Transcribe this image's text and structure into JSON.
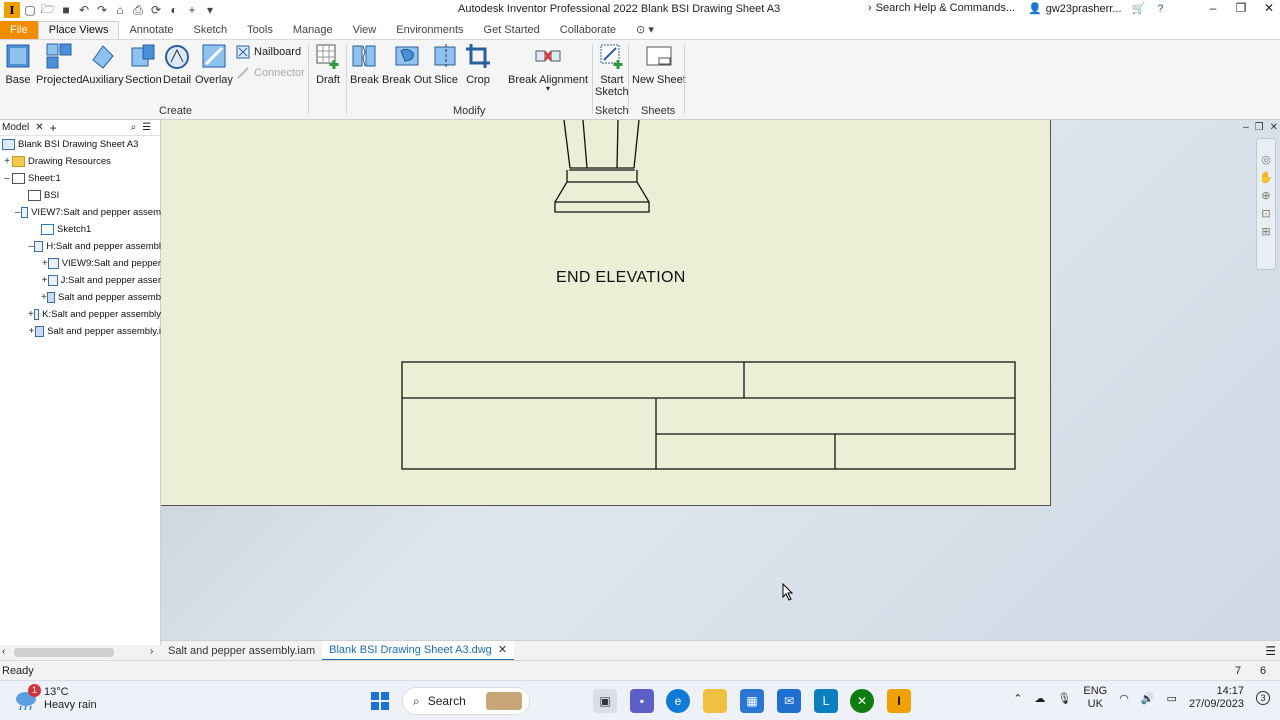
{
  "window": {
    "title": "Autodesk Inventor Professional 2022   Blank BSI Drawing Sheet A3",
    "search_placeholder": "Search Help & Commands...",
    "user": "gw23prasherr..."
  },
  "ribbon_tabs": [
    {
      "label": "File"
    },
    {
      "label": "Place Views"
    },
    {
      "label": "Annotate"
    },
    {
      "label": "Sketch"
    },
    {
      "label": "Tools"
    },
    {
      "label": "Manage"
    },
    {
      "label": "View"
    },
    {
      "label": "Environments"
    },
    {
      "label": "Get Started"
    },
    {
      "label": "Collaborate"
    }
  ],
  "ribbon": {
    "create": {
      "label": "Create",
      "base": "Base",
      "projected": "Projected",
      "auxiliary": "Auxiliary",
      "section": "Section",
      "detail": "Detail",
      "overlay": "Overlay",
      "nailboard": "Nailboard",
      "connector": "Connector",
      "draft": "Draft"
    },
    "modify": {
      "label": "Modify",
      "break": "Break",
      "break_out": "Break Out",
      "slice": "Slice",
      "crop": "Crop",
      "break_alignment": "Break Alignment"
    },
    "sketch": {
      "label": "Sketch",
      "start_sketch_1": "Start",
      "start_sketch_2": "Sketch"
    },
    "sheets": {
      "label": "Sheets",
      "new_sheet": "New Sheet"
    }
  },
  "browser": {
    "title": "Model",
    "items": [
      {
        "label": "Blank BSI Drawing Sheet A3"
      },
      {
        "label": "Drawing Resources"
      },
      {
        "label": "Sheet:1"
      },
      {
        "label": "BSI"
      },
      {
        "label": "VIEW7:Salt and pepper assem"
      },
      {
        "label": "Sketch1"
      },
      {
        "label": "H:Salt and pepper assembl"
      },
      {
        "label": "VIEW9:Salt and pepper"
      },
      {
        "label": "J:Salt and pepper asser"
      },
      {
        "label": "Salt and pepper assemb"
      },
      {
        "label": "K:Salt and pepper assembly"
      },
      {
        "label": "Salt and pepper assembly.i"
      }
    ]
  },
  "drawing": {
    "view_label": "END ELEVATION"
  },
  "doc_tabs": [
    {
      "label": "Salt and pepper assembly.iam"
    },
    {
      "label": "Blank BSI Drawing Sheet A3.dwg"
    }
  ],
  "status": {
    "text": "Ready",
    "val1": "7",
    "val2": "6"
  },
  "taskbar": {
    "weather_temp": "13°C",
    "weather_desc": "Heavy rain",
    "weather_badge": "1",
    "search_label": "Search",
    "lang_1": "ENG",
    "lang_2": "UK",
    "time": "14:17",
    "date": "27/09/2023",
    "notif_count": "3"
  }
}
